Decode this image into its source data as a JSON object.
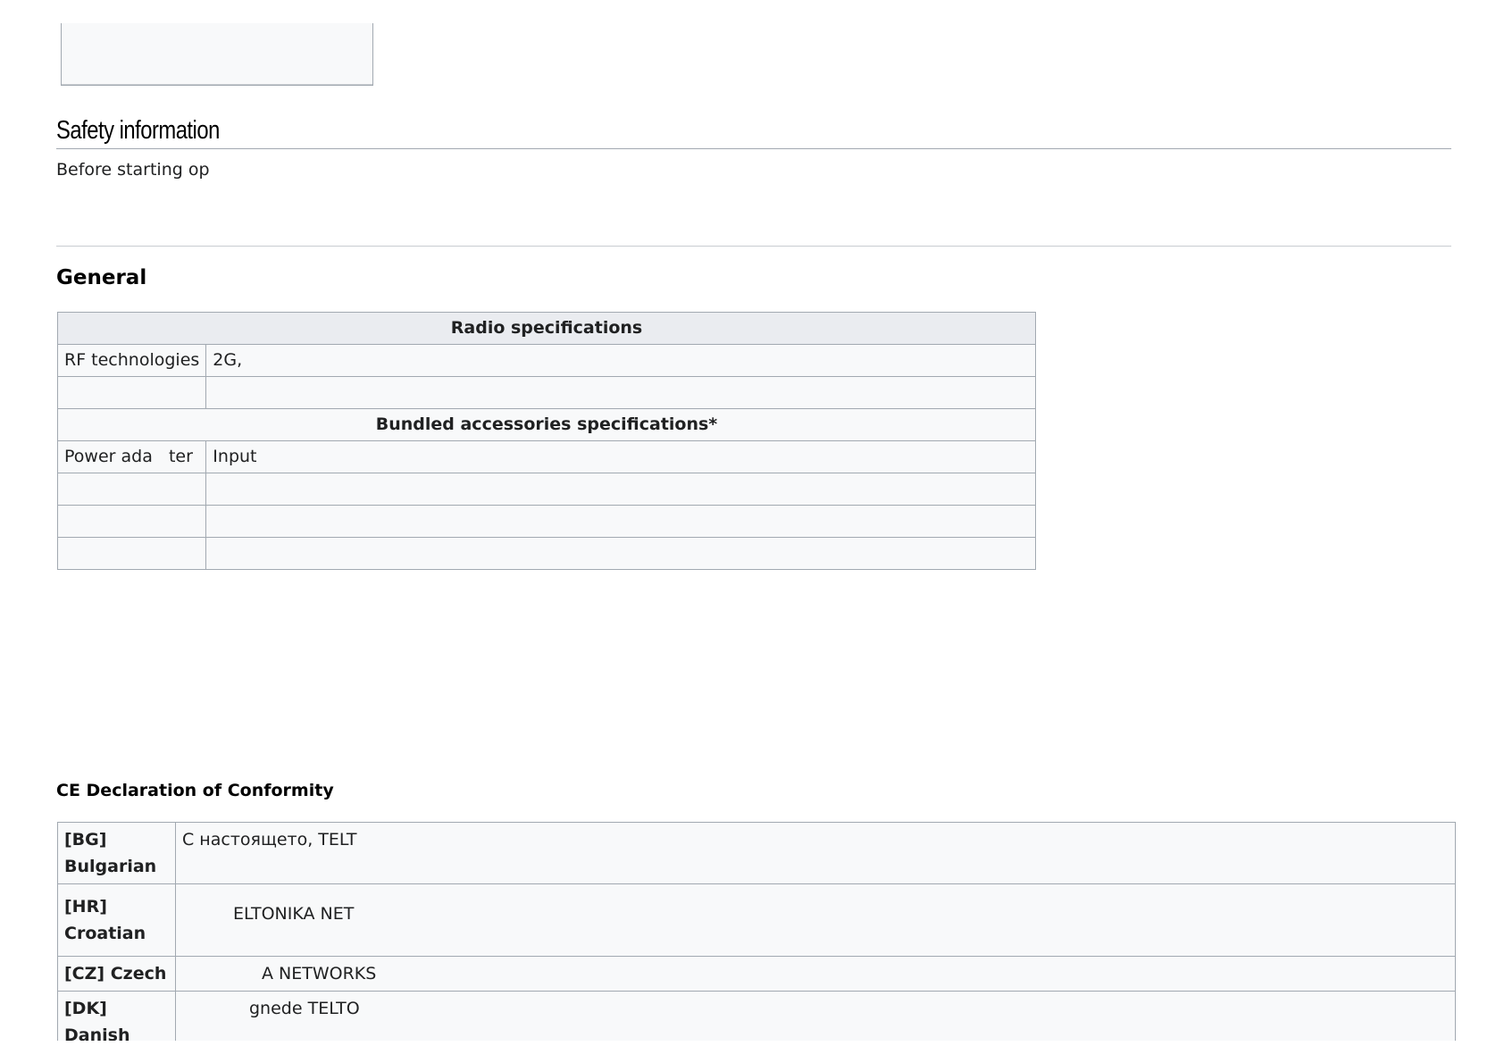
{
  "safety": {
    "title": "Safety information",
    "intro": "Before starting op"
  },
  "general": {
    "title": "General"
  },
  "radio_table": {
    "header": "Radio specifications",
    "rows": [
      {
        "label": "RF technologies",
        "value": "2G,"
      },
      {
        "label": "",
        "value": ""
      }
    ],
    "accessories_header": "Bundled accessories specifications*",
    "accessory_rows": [
      {
        "label": "Power ada   ter",
        "value": "Input"
      },
      {
        "label": "",
        "value": ""
      },
      {
        "label": "",
        "value": ""
      },
      {
        "label": "",
        "value": ""
      }
    ]
  },
  "ce": {
    "title": "CE Declaration of Conformity",
    "rows": [
      {
        "lang": "[BG] Bulgarian",
        "text": "С настоящето, TELT"
      },
      {
        "lang": "[HR] Croatian",
        "text": "ELTONIKA NET"
      },
      {
        "lang": "[CZ] Czech",
        "text": "A NETWORKS"
      },
      {
        "lang": "[DK] Danish",
        "text": "gnede TELTO"
      }
    ]
  }
}
